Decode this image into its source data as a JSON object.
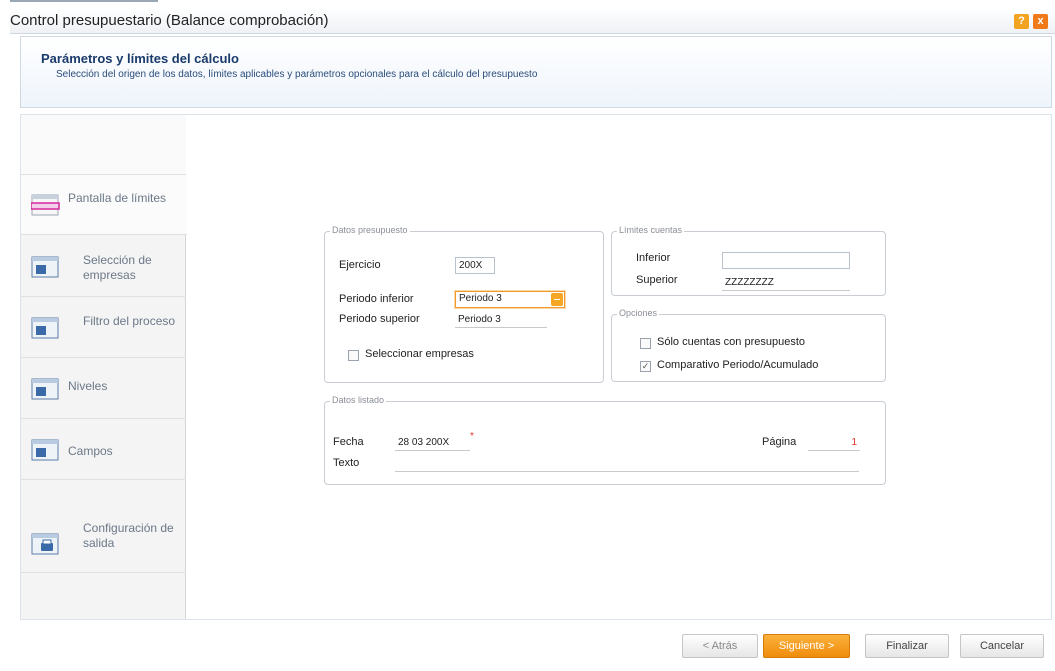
{
  "window": {
    "title": "Control presupuestario (Balance comprobación)",
    "help_icon": "?",
    "close_icon": "x"
  },
  "header": {
    "title": "Parámetros y límites del cálculo",
    "subtitle": "Selección del origen de los datos, límites aplicables y parámetros opcionales para el cálculo del presupuesto"
  },
  "sidebar": {
    "items": [
      {
        "label": "Pantalla de límites",
        "icon": "screen-limits-icon",
        "active": true
      },
      {
        "label": "Selección de empresas",
        "icon": "companies-icon"
      },
      {
        "label": "Filtro del proceso",
        "icon": "filter-icon"
      },
      {
        "label": "Niveles",
        "icon": "levels-icon"
      },
      {
        "label": "Campos",
        "icon": "fields-icon"
      },
      {
        "label": "Configuración de salida",
        "icon": "output-config-icon"
      }
    ]
  },
  "datos_presupuesto": {
    "legend": "Datos presupuesto",
    "ejercicio_label": "Ejercicio",
    "ejercicio_value": "200X",
    "periodo_inferior_label": "Periodo inferior",
    "periodo_inferior_value": "Periodo 3",
    "periodo_superior_label": "Periodo superior",
    "periodo_superior_value": "Periodo 3",
    "seleccionar_empresas_label": "Seleccionar empresas"
  },
  "limites_cuentas": {
    "legend": "Límites cuentas",
    "inferior_label": "Inferior",
    "inferior_value": "",
    "superior_label": "Superior",
    "superior_value": "ZZZZZZZZ"
  },
  "opciones": {
    "legend": "Opciones",
    "solo_cuentas_label": "Sólo cuentas con presupuesto",
    "comparativo_label": "Comparativo Periodo/Acumulado"
  },
  "datos_listado": {
    "legend": "Datos listado",
    "fecha_label": "Fecha",
    "fecha_value": "28 03 200X",
    "pagina_label": "Página",
    "pagina_value": "1",
    "texto_label": "Texto",
    "texto_value": ""
  },
  "footer": {
    "back_label": "< Atrás",
    "next_label": "Siguiente >",
    "finish_label": "Finalizar",
    "cancel_label": "Cancelar"
  },
  "colors": {
    "accent": "#f5a623",
    "header_text": "#1a3a6b"
  }
}
